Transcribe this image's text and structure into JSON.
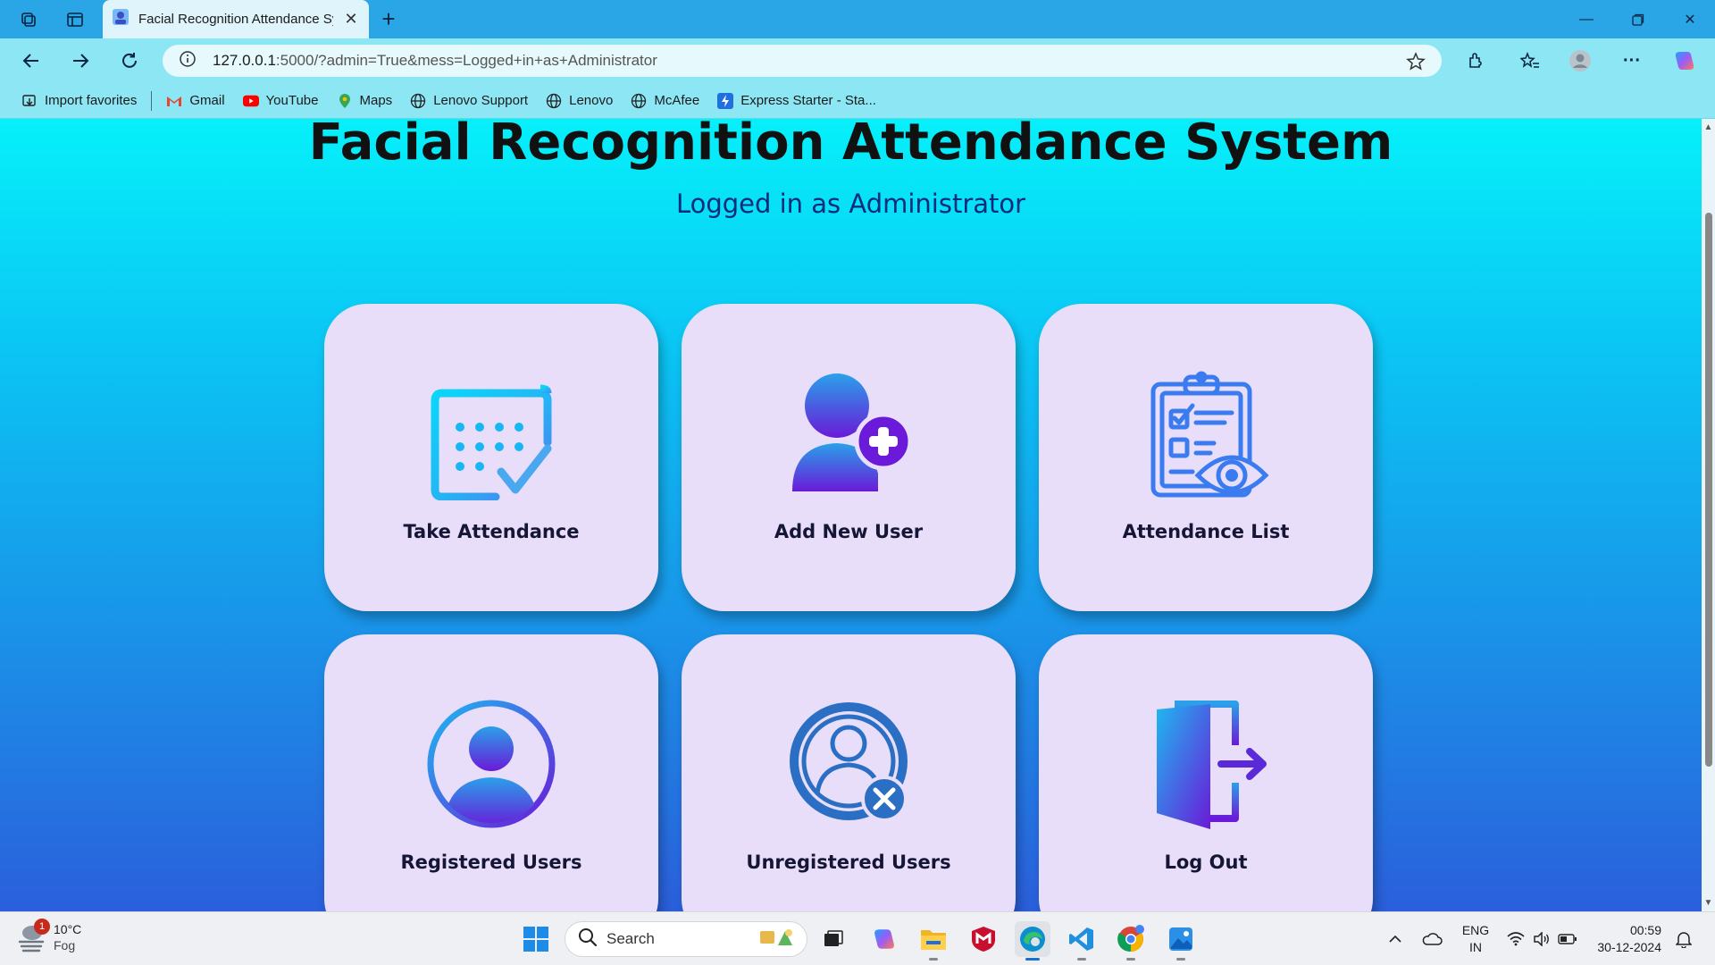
{
  "browser": {
    "tab_title": "Facial Recognition Attendance Sy",
    "address_host": "127.0.0.1",
    "address_rest": ":5000/?admin=True&mess=Logged+in+as+Administrator",
    "favorites": [
      {
        "label": "Import favorites",
        "icon": "import-icon"
      },
      {
        "label": "Gmail",
        "icon": "gmail-icon"
      },
      {
        "label": "YouTube",
        "icon": "youtube-icon"
      },
      {
        "label": "Maps",
        "icon": "maps-icon"
      },
      {
        "label": "Lenovo Support",
        "icon": "globe-icon"
      },
      {
        "label": "Lenovo",
        "icon": "globe-icon"
      },
      {
        "label": "McAfee",
        "icon": "globe-icon"
      },
      {
        "label": "Express Starter - Sta...",
        "icon": "bolt-icon"
      }
    ]
  },
  "page": {
    "title": "Facial Recognition Attendance System",
    "subtitle": "Logged in as Administrator",
    "cards": [
      {
        "label": "Take Attendance",
        "icon": "calendar-check-icon"
      },
      {
        "label": "Add New User",
        "icon": "user-add-icon"
      },
      {
        "label": "Attendance List",
        "icon": "clipboard-eye-icon"
      },
      {
        "label": "Registered Users",
        "icon": "user-circle-icon"
      },
      {
        "label": "Unregistered Users",
        "icon": "user-remove-icon"
      },
      {
        "label": "Log Out",
        "icon": "logout-door-icon"
      }
    ]
  },
  "taskbar": {
    "weather_temp": "10°C",
    "weather_cond": "Fog",
    "weather_badge": "1",
    "search_placeholder": "Search",
    "lang_line1": "ENG",
    "lang_line2": "IN",
    "time": "00:59",
    "date": "30-12-2024"
  },
  "colors": {
    "page_gradient_top": "#06f0fa",
    "page_gradient_bottom": "#2b5fdc",
    "card_bg": "#e8defa",
    "icon_gradient_start": "#1fb8f0",
    "icon_gradient_end": "#6a1ad8"
  }
}
